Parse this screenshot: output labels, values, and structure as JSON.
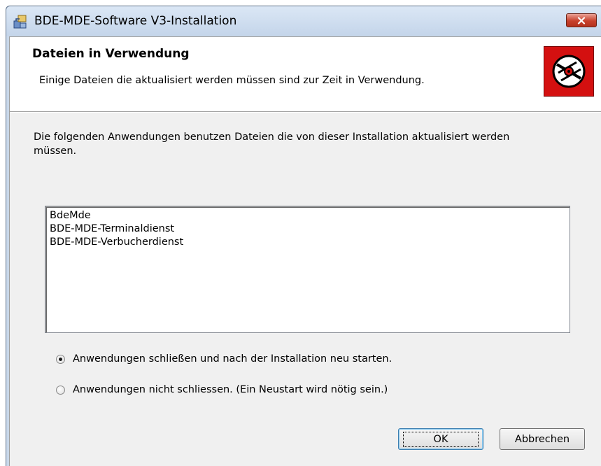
{
  "window": {
    "title": "BDE-MDE-Software V3-Installation"
  },
  "banner": {
    "title": "Dateien in Verwendung",
    "description": "Einige Dateien die aktualisiert werden müssen sind zur Zeit in Verwendung.",
    "logo_icon": "cd-disc-icon"
  },
  "body": {
    "text": "Die folgenden Anwendungen benutzen Dateien die von dieser Installation aktualisiert werden müssen."
  },
  "applications": [
    "BdeMde",
    "BDE-MDE-Terminaldienst",
    "BDE-MDE-Verbucherdienst"
  ],
  "options": {
    "close_restart": {
      "label": "Anwendungen schließen und nach der Installation neu starten.",
      "selected": true
    },
    "no_close": {
      "label": "Anwendungen nicht schliessen. (Ein Neustart wird nötig sein.)",
      "selected": false
    }
  },
  "buttons": {
    "ok": "OK",
    "cancel": "Abbrechen"
  },
  "colors": {
    "logo_background": "#d41010",
    "close_button": "#c8412c"
  }
}
